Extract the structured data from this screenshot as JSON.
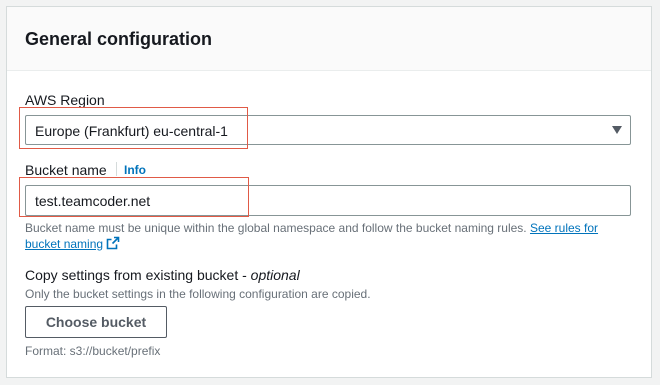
{
  "panel": {
    "title": "General configuration"
  },
  "region": {
    "label": "AWS Region",
    "selected": "Europe (Frankfurt) eu-central-1",
    "icon": "caret-down-icon"
  },
  "bucket_name": {
    "label": "Bucket name",
    "info_link": "Info",
    "value": "test.teamcoder.net",
    "helper_text": "Bucket name must be unique within the global namespace and follow the bucket naming rules.",
    "rules_link": "See rules for bucket naming",
    "rules_link_icon": "external-link-icon"
  },
  "copy_settings": {
    "label": "Copy settings from existing bucket - ",
    "optional": "optional",
    "description": "Only the bucket settings in the following configuration are copied.",
    "button_label": "Choose bucket",
    "format_hint": "Format: s3://bucket/prefix"
  },
  "colors": {
    "link": "#0073bb",
    "highlight": "#e05a46",
    "border": "#879596",
    "header_bg": "#fafafa"
  }
}
